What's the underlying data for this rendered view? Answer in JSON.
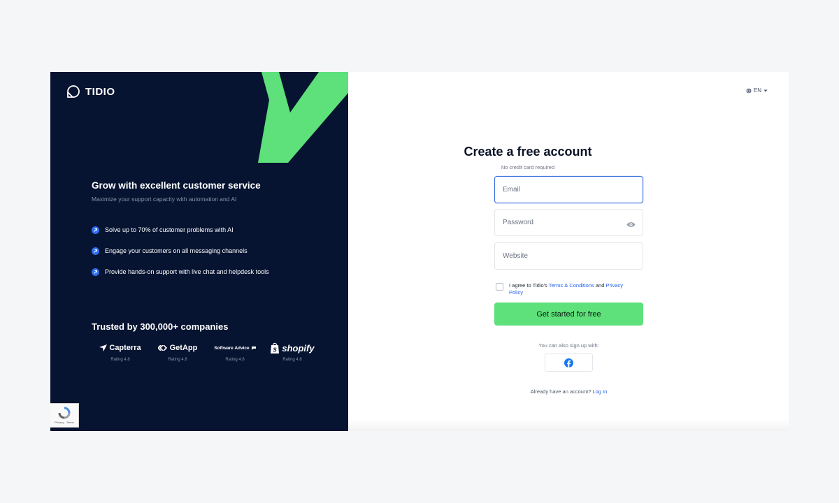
{
  "brand": {
    "name": "TIDIO"
  },
  "colors": {
    "navy": "#061431",
    "green": "#5ee07a",
    "blue": "#2563eb",
    "focus": "#3b6fe0"
  },
  "left": {
    "headline": "Grow with excellent customer service",
    "subline": "Maximize your support capacity with automation and AI",
    "features": [
      "Solve up to 70% of customer problems with AI",
      "Engage your customers on all messaging channels",
      "Provide hands-on support with live chat and helpdesk tools"
    ],
    "trusted": "Trusted by 300,000+ companies",
    "brands": [
      {
        "name": "Capterra",
        "icon": "capterra-icon",
        "rating": "Rating 4.8"
      },
      {
        "name": "GetApp",
        "icon": "getapp-icon",
        "rating": "Rating 4.8"
      },
      {
        "name": "Software Advice",
        "icon": "software-advice-icon",
        "rating": "Rating 4.8"
      },
      {
        "name": "shopify",
        "icon": "shopify-bag-icon",
        "rating": "Rating 4.8"
      }
    ],
    "recaptcha": "Privacy - Terms"
  },
  "right": {
    "language": "EN",
    "title": "Create a free account",
    "subtitle": "No credit card required",
    "email_placeholder": "Email",
    "password_placeholder": "Password",
    "website_placeholder": "Website",
    "agree_prefix": "I agree to Tidio's ",
    "terms_link": "Terms & Conditions",
    "agree_and": " and ",
    "privacy_link": "Privacy Policy",
    "cta": "Get started for free",
    "also_signup": "You can also sign up with:",
    "login_prompt": "Already have an account? ",
    "login_link": "Log In"
  }
}
